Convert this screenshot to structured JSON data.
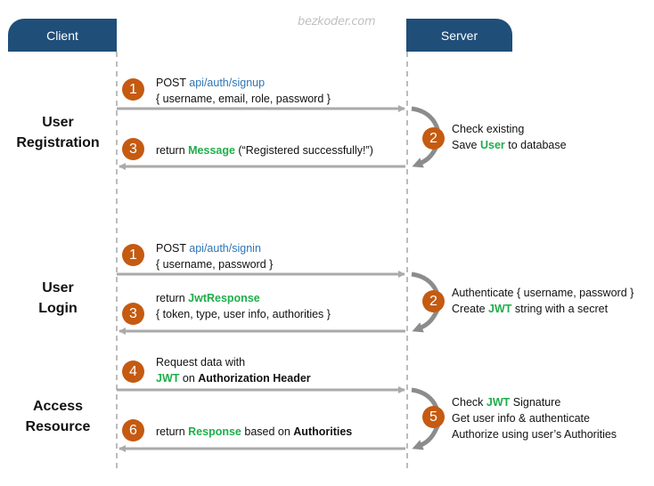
{
  "watermark": "bezkoder.com",
  "actors": {
    "client": "Client",
    "server": "Server"
  },
  "colors": {
    "header": "#1f4e79",
    "badge": "#c55a11",
    "endpoint": "#2e75b6",
    "highlight": "#1fae4b",
    "arrow": "#aaaaaa",
    "lifeline": "#999999"
  },
  "sections": [
    {
      "label_line1": "User",
      "label_line2": "Registration",
      "request": {
        "step": "1",
        "parts": [
          {
            "text": "POST "
          },
          {
            "text": "api/auth/signup",
            "style": "blue"
          }
        ],
        "line2": [
          {
            "text": "{ username, email, role, password }"
          }
        ]
      },
      "server": {
        "step": "2",
        "lines": [
          [
            {
              "text": "Check existing"
            }
          ],
          [
            {
              "text": "Save "
            },
            {
              "text": "User",
              "style": "green"
            },
            {
              "text": " to database"
            }
          ]
        ]
      },
      "response": {
        "step": "3",
        "line1": [
          {
            "text": "return "
          },
          {
            "text": "Message",
            "style": "green"
          },
          {
            "text": " (“Registered successfully!”)"
          }
        ],
        "line2": []
      }
    },
    {
      "label_line1": "User",
      "label_line2": "Login",
      "request": {
        "step": "1",
        "parts": [
          {
            "text": "POST "
          },
          {
            "text": "api/auth/signin",
            "style": "blue"
          }
        ],
        "line2": [
          {
            "text": "{ username, password }"
          }
        ]
      },
      "server": {
        "step": "2",
        "lines": [
          [
            {
              "text": "Authenticate { username, password }"
            }
          ],
          [
            {
              "text": "Create "
            },
            {
              "text": "JWT",
              "style": "green"
            },
            {
              "text": " string with a secret"
            }
          ]
        ]
      },
      "response": {
        "step": "3",
        "line1": [
          {
            "text": "return "
          },
          {
            "text": "JwtResponse",
            "style": "green"
          }
        ],
        "line2": [
          {
            "text": "{ token, type, user info, authorities }"
          }
        ]
      }
    },
    {
      "label_line1": "Access",
      "label_line2": "Resource",
      "request": {
        "step": "4",
        "parts": [
          {
            "text": "Request  data with"
          }
        ],
        "line2": [
          {
            "text": "JWT",
            "style": "green"
          },
          {
            "text": " on "
          },
          {
            "text": "Authorization Header",
            "style": "bold"
          }
        ]
      },
      "server": {
        "step": "5",
        "lines": [
          [
            {
              "text": "Check "
            },
            {
              "text": "JWT",
              "style": "green"
            },
            {
              "text": " Signature"
            }
          ],
          [
            {
              "text": "Get user info & authenticate"
            }
          ],
          [
            {
              "text": "Authorize using user’s Authorities"
            }
          ]
        ]
      },
      "response": {
        "step": "6",
        "line1": [
          {
            "text": "return "
          },
          {
            "text": "Response",
            "style": "green"
          },
          {
            "text": " based on "
          },
          {
            "text": "Authorities",
            "style": "bold"
          }
        ],
        "line2": []
      }
    }
  ]
}
